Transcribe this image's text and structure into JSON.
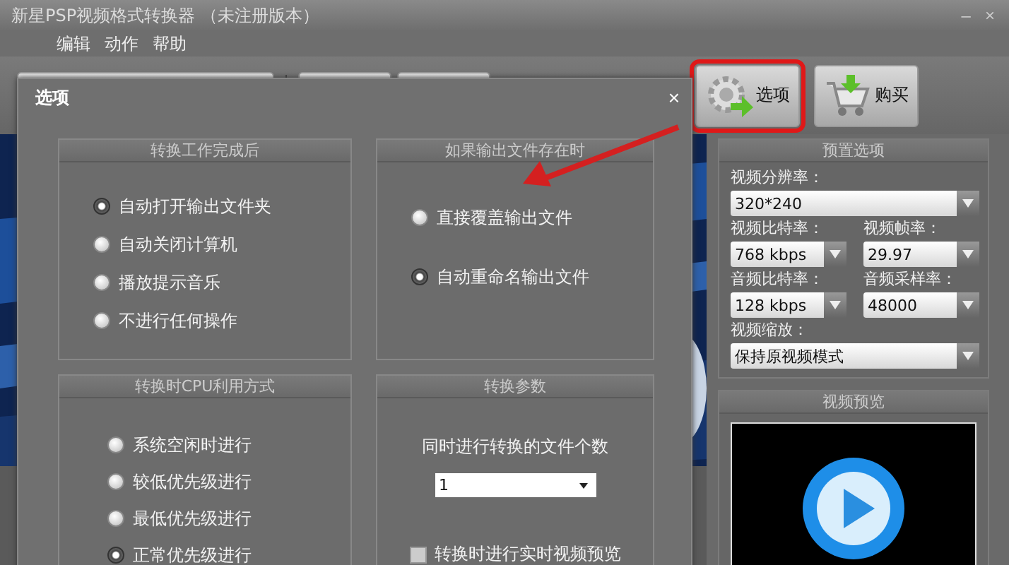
{
  "window": {
    "title": "新星PSP视频格式转换器 （未注册版本）",
    "controls": [
      "–",
      "×"
    ]
  },
  "menu": [
    "编辑",
    "动作",
    "帮助"
  ],
  "toolbar": [
    {
      "label": "选项",
      "kind": "settings",
      "highlighted": true
    },
    {
      "label": "购买",
      "kind": "buy",
      "highlighted": false
    }
  ],
  "preset_panel": {
    "title": "预置选项",
    "rows": [
      [
        {
          "label": "视频分辨率：",
          "value": "320*240"
        }
      ],
      [
        {
          "label": "视频比特率：",
          "value": "768 kbps"
        },
        {
          "label": "视频帧率：",
          "value": "29.97"
        }
      ],
      [
        {
          "label": "音频比特率：",
          "value": "128 kbps"
        },
        {
          "label": "音频采样率：",
          "value": "48000"
        }
      ],
      [
        {
          "label": "视频缩放：",
          "value": "保持原视频模式"
        }
      ]
    ]
  },
  "preview_panel": {
    "title": "视频预览"
  },
  "dialog": {
    "title": "选项",
    "close": "×",
    "groups": [
      {
        "title": "转换工作完成后",
        "kind": "radios",
        "options": [
          {
            "label": "自动打开输出文件夹",
            "selected": true
          },
          {
            "label": "自动关闭计算机",
            "selected": false
          },
          {
            "label": "播放提示音乐",
            "selected": false
          },
          {
            "label": "不进行任何操作",
            "selected": false
          }
        ]
      },
      {
        "title": "如果输出文件存在时",
        "kind": "radios",
        "options": [
          {
            "label": "直接覆盖输出文件",
            "selected": false
          },
          {
            "label": "自动重命名输出文件",
            "selected": true
          }
        ]
      },
      {
        "title": "转换时CPU利用方式",
        "kind": "radios",
        "options": [
          {
            "label": "系统空闲时进行",
            "selected": false
          },
          {
            "label": "较低优先级进行",
            "selected": false
          },
          {
            "label": "最低优先级进行",
            "selected": false
          },
          {
            "label": "正常优先级进行",
            "selected": true
          }
        ]
      },
      {
        "title": "转换参数",
        "kind": "params",
        "prompt": "同时进行转换的文件个数",
        "select": "1",
        "checkbox": {
          "label": "转换时进行实时视频预览",
          "checked": false
        }
      }
    ]
  }
}
